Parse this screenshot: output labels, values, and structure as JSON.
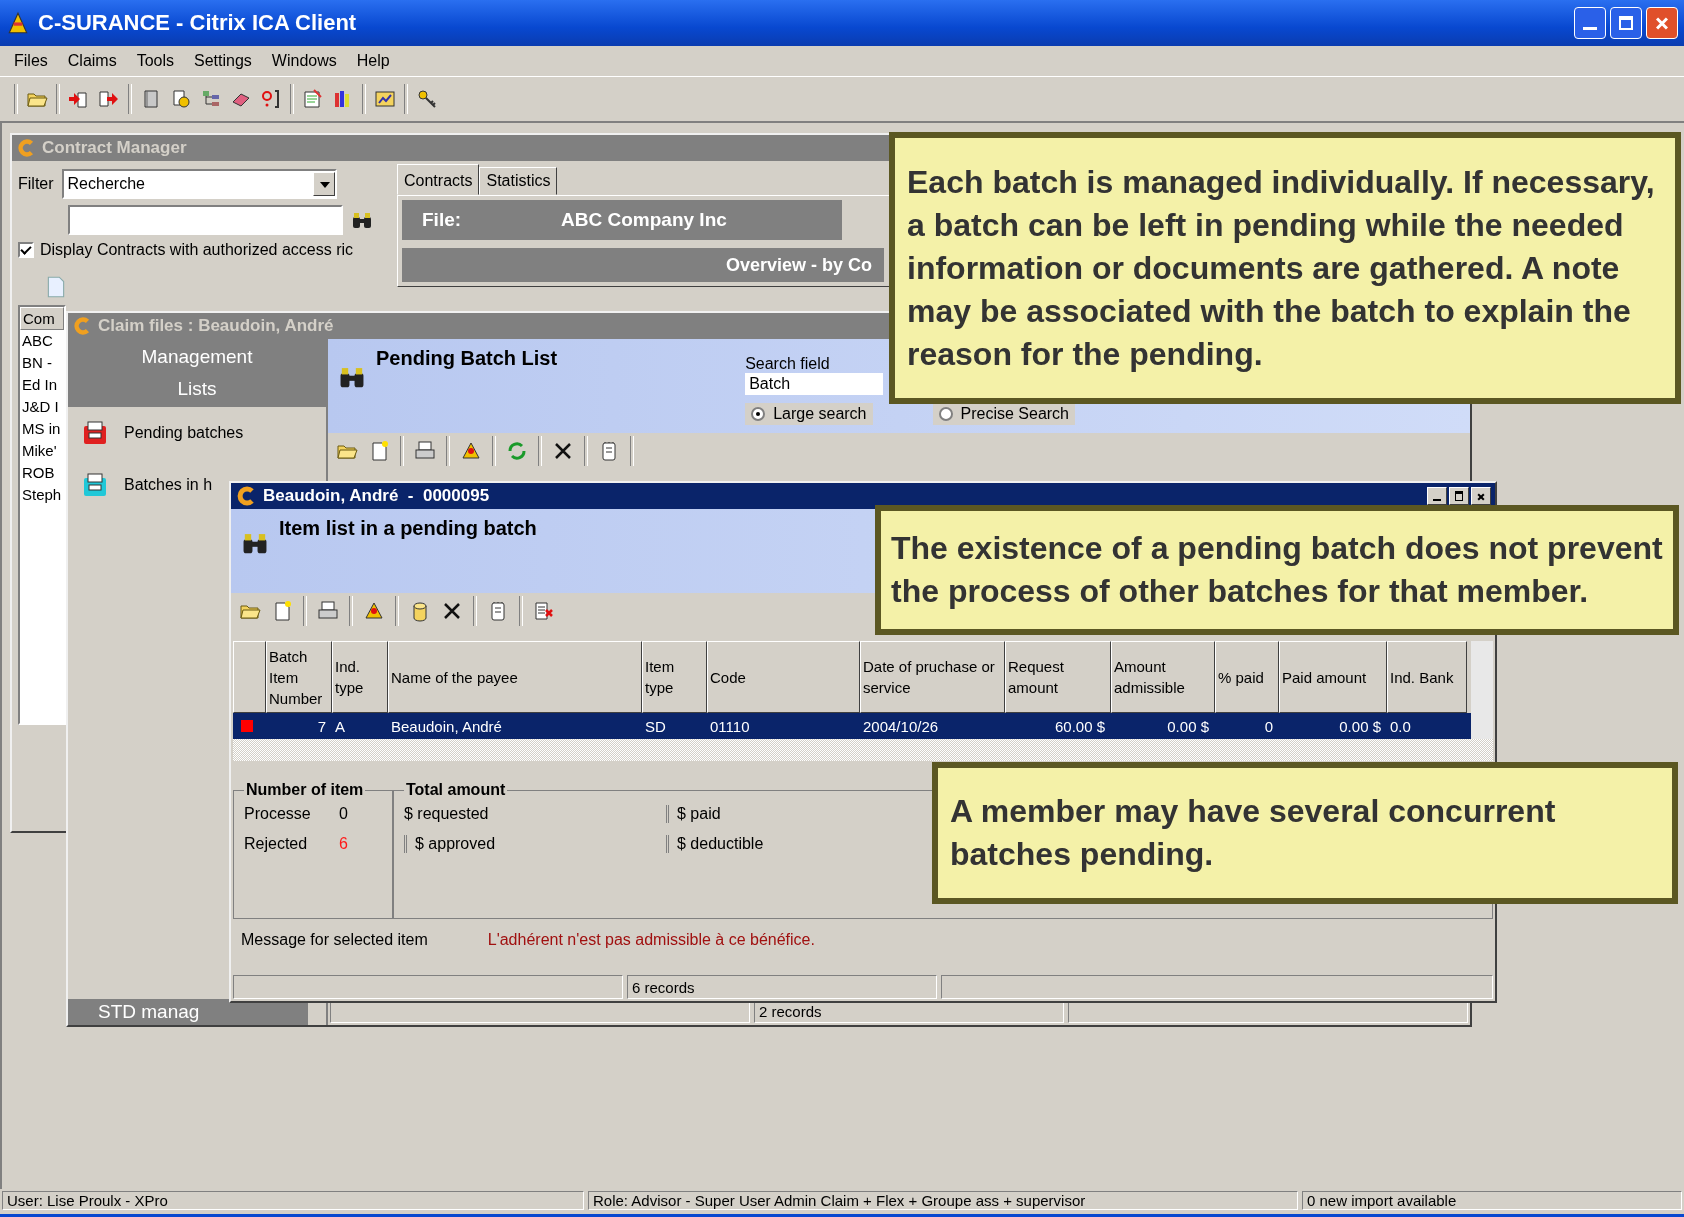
{
  "app": {
    "title": "C-SURANCE - Citrix ICA Client"
  },
  "menu": [
    "Files",
    "Claims",
    "Tools",
    "Settings",
    "Windows",
    "Help"
  ],
  "contract_manager": {
    "title": "Contract Manager",
    "active": false,
    "filter_label": "Filter",
    "filter_value": "Recherche",
    "display_checkbox": {
      "label": "Display Contracts with authorized access ric",
      "checked": true
    },
    "tabs": [
      {
        "label": "Contracts",
        "selected": true
      },
      {
        "label": "Statistics",
        "selected": false
      }
    ],
    "file_label": "File:",
    "file_value": "ABC Company Inc",
    "overview": "Overview - by Co",
    "list_header": "Com",
    "list": [
      "ABC",
      "BN -",
      "Ed In",
      "J&D I",
      "MS in",
      "Mike'",
      "ROB",
      "Steph"
    ]
  },
  "claim_files": {
    "title": "Claim files : Beaudoin, André",
    "active": false,
    "side_header": "Management Lists",
    "side_items": [
      {
        "label": "Pending batches",
        "color": "#e02020"
      },
      {
        "label": "Batches in h",
        "color": "#20c8d8"
      }
    ],
    "side_footer": "STD manag",
    "heading": "Pending Batch List",
    "search_label": "Search field",
    "search_value": "Batch",
    "search_modes": [
      {
        "label": "Large search",
        "selected": true
      },
      {
        "label": "Precise Search",
        "selected": false
      }
    ],
    "status": "2 records"
  },
  "batch_window": {
    "title": "Beaudoin, André  -  0000095",
    "active": true,
    "heading": "Item list in a pending batch",
    "columns": [
      "Batch Item Number",
      "Ind. type",
      "Name of the payee",
      "Item type",
      "Code",
      "Date of pruchase or service",
      "Request amount",
      "Amount admissible",
      "% paid",
      "Paid amount",
      "Ind. Bank"
    ],
    "rows": [
      {
        "selected": true,
        "rejected": true,
        "cells": [
          "7",
          "A",
          "Beaudoin, André",
          "SD",
          "01110",
          "2004/10/26",
          "60.00 $",
          "0.00 $",
          "0",
          "0.00 $",
          "0.0"
        ]
      }
    ],
    "counts_title": "Number of item",
    "counts": [
      {
        "label": "Processe",
        "value": "0",
        "kind": "normal"
      },
      {
        "label": "Rejected",
        "value": "6",
        "kind": "error"
      }
    ],
    "totals_title": "Total amount",
    "totals": [
      "$ requested",
      "$ approved",
      "$ paid",
      "$ deductible"
    ],
    "message_label": "Message for selected item",
    "message": "L'adhérent n'est pas admissible à ce bénéfice.",
    "status": "6 records"
  },
  "callouts": [
    "Each batch is managed individually. If necessary, a batch can be left in pending while the needed information or documents are gathered. A note may be associated with the batch to explain the reason for the pending.",
    "The existence of a pending batch does not prevent the process of other batches for that member.",
    "A member may have several concurrent batches pending."
  ],
  "status_bar": [
    "User: Lise Proulx - XPro",
    "Role: Advisor - Super User Admin Claim + Flex + Groupe ass + supervisor",
    "0 new import available"
  ]
}
